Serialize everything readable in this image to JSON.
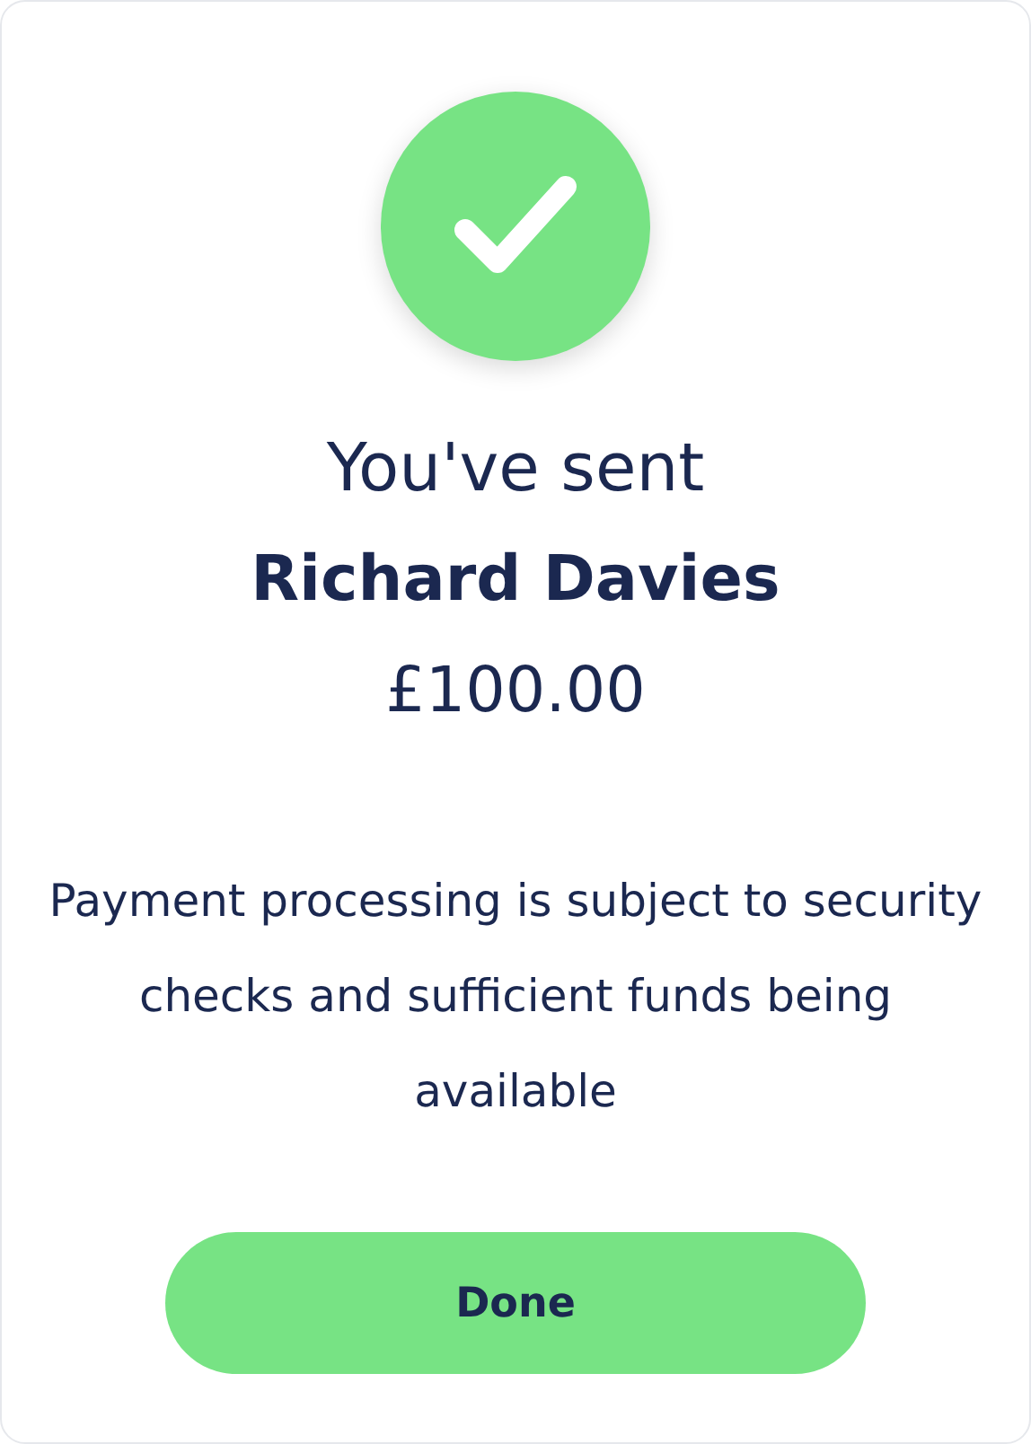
{
  "confirmation": {
    "heading": "You've sent",
    "recipient": "Richard Davies",
    "amount": "£100.00",
    "note": "Payment processing is subject to security checks and sufficient funds being available"
  },
  "buttons": [
    "Done"
  ]
}
